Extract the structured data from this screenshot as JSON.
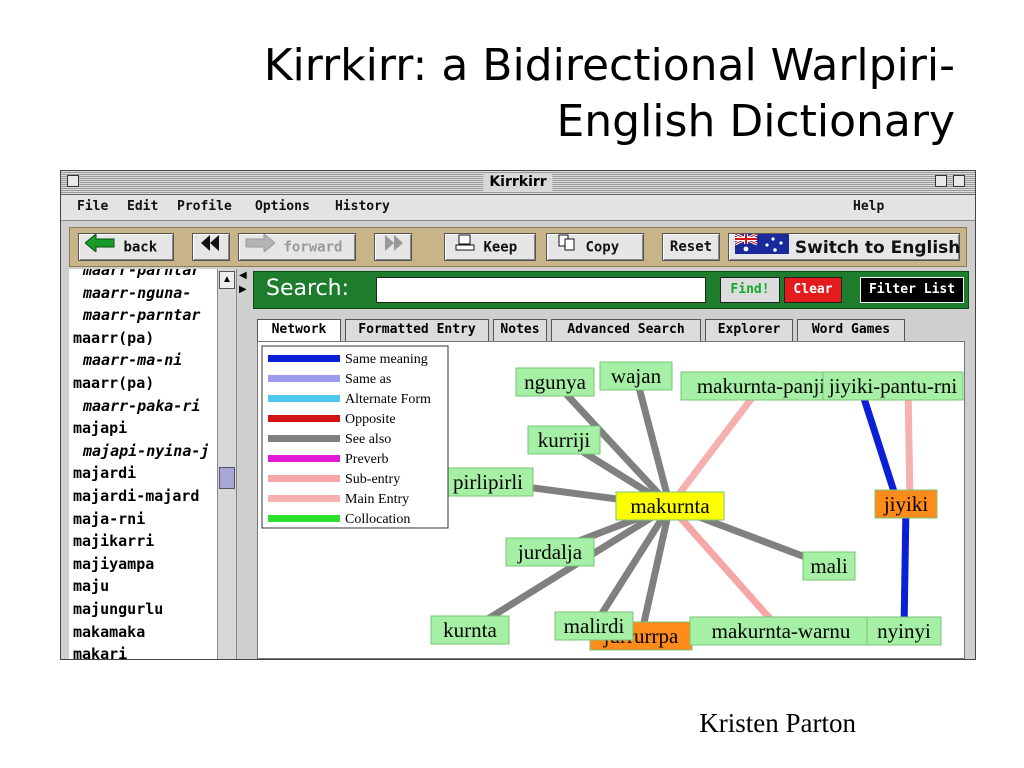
{
  "slide": {
    "title_line1": "Kirrkirr: a Bidirectional Warlpiri-",
    "title_line2": "English Dictionary",
    "author": "Kristen Parton"
  },
  "window": {
    "title": "Kirrkirr"
  },
  "menu": {
    "file": "File",
    "edit": "Edit",
    "profile": "Profile",
    "options": "Options",
    "history": "History",
    "help": "Help"
  },
  "toolbar": {
    "back": "back",
    "forward": "forward",
    "keep": "Keep",
    "copy": "Copy",
    "reset": "Reset",
    "switch": "Switch to English",
    "icons": [
      "back-arrow-icon",
      "double-left-icon",
      "forward-arrow-icon",
      "double-right-icon",
      "keep-icon",
      "copy-icon",
      "australian-flag-icon"
    ]
  },
  "wordlist": {
    "items": [
      {
        "text": "maarr-parntar",
        "sub": true
      },
      {
        "text": "maarr-nguna-",
        "sub": true
      },
      {
        "text": "maarr-parntar",
        "sub": true
      },
      {
        "text": "maarr(pa)",
        "sub": false
      },
      {
        "text": "maarr-ma-ni",
        "sub": true
      },
      {
        "text": "maarr(pa)",
        "sub": false
      },
      {
        "text": "maarr-paka-ri",
        "sub": true
      },
      {
        "text": "majapi",
        "sub": false
      },
      {
        "text": "majapi-nyina-j",
        "sub": true
      },
      {
        "text": "majardi",
        "sub": false
      },
      {
        "text": "majardi-majard",
        "sub": false
      },
      {
        "text": "maja-rni",
        "sub": false
      },
      {
        "text": "majikarri",
        "sub": false
      },
      {
        "text": "majiyampa",
        "sub": false
      },
      {
        "text": "maju",
        "sub": false
      },
      {
        "text": "majungurlu",
        "sub": false
      },
      {
        "text": "makamaka",
        "sub": false
      },
      {
        "text": "makari",
        "sub": false
      }
    ]
  },
  "search": {
    "label": "Search:",
    "value": "",
    "find": "Find!",
    "clear": "Clear",
    "filter": "Filter List",
    "colors": {
      "panel": "#1e7d2c",
      "find_text": "#11a82a",
      "clear_bg": "#e21c1c"
    }
  },
  "tabs": [
    "Network",
    "Formatted Entry",
    "Notes",
    "Advanced Search",
    "Explorer",
    "Word Games"
  ],
  "legend": [
    {
      "label": "Same meaning",
      "color": "#0b1fd6"
    },
    {
      "label": "Same as",
      "color": "#9b9cee"
    },
    {
      "label": "Alternate Form",
      "color": "#4fc8ee"
    },
    {
      "label": "Opposite",
      "color": "#d21414"
    },
    {
      "label": "See also",
      "color": "#808080"
    },
    {
      "label": "Preverb",
      "color": "#e21ad8"
    },
    {
      "label": "Sub-entry",
      "color": "#f5a6a6"
    },
    {
      "label": "Main Entry",
      "color": "#f5b0b0"
    },
    {
      "label": "Collocation",
      "color": "#2ee02e"
    }
  ],
  "network": {
    "node_colors": {
      "green": "#a6f0a6",
      "yellow": "#ffff00",
      "orange": "#ff8c1a"
    },
    "nodes": [
      {
        "label": "ngunya",
        "color": "green"
      },
      {
        "label": "wajan",
        "color": "green"
      },
      {
        "label": "makurnta-panji",
        "color": "green"
      },
      {
        "label": "jiyiki-pantu-rni",
        "color": "green"
      },
      {
        "label": "kurriji",
        "color": "green"
      },
      {
        "label": "pirlipirli",
        "color": "green"
      },
      {
        "label": "makurnta",
        "color": "yellow"
      },
      {
        "label": "jiyiki",
        "color": "orange"
      },
      {
        "label": "jurdalja",
        "color": "green"
      },
      {
        "label": "mali",
        "color": "green"
      },
      {
        "label": "kurnta",
        "color": "green"
      },
      {
        "label": "jurrurrpa",
        "color": "orange"
      },
      {
        "label": "malirdi",
        "color": "green"
      },
      {
        "label": "makurnta-warnu",
        "color": "green"
      },
      {
        "label": "nyinyi",
        "color": "green"
      }
    ],
    "edges": [
      {
        "from": "makurnta",
        "to": "ngunya",
        "type": "See also"
      },
      {
        "from": "makurnta",
        "to": "wajan",
        "type": "See also"
      },
      {
        "from": "makurnta",
        "to": "makurnta-panji",
        "type": "Main Entry"
      },
      {
        "from": "makurnta",
        "to": "kurriji",
        "type": "See also"
      },
      {
        "from": "makurnta",
        "to": "pirlipirli",
        "type": "See also"
      },
      {
        "from": "makurnta",
        "to": "jurdalja",
        "type": "See also"
      },
      {
        "from": "makurnta",
        "to": "mali",
        "type": "See also"
      },
      {
        "from": "makurnta",
        "to": "kurnta",
        "type": "See also"
      },
      {
        "from": "makurnta",
        "to": "jurrurrpa",
        "type": "See also"
      },
      {
        "from": "makurnta",
        "to": "malirdi",
        "type": "See also"
      },
      {
        "from": "makurnta",
        "to": "makurnta-warnu",
        "type": "Sub-entry"
      },
      {
        "from": "jiyiki",
        "to": "jiyiki-pantu-rni",
        "type": "Same meaning"
      },
      {
        "from": "jiyiki",
        "to": "jiyiki-pantu-rni",
        "type": "Main Entry"
      },
      {
        "from": "jiyiki",
        "to": "nyinyi",
        "type": "Same meaning"
      }
    ]
  }
}
